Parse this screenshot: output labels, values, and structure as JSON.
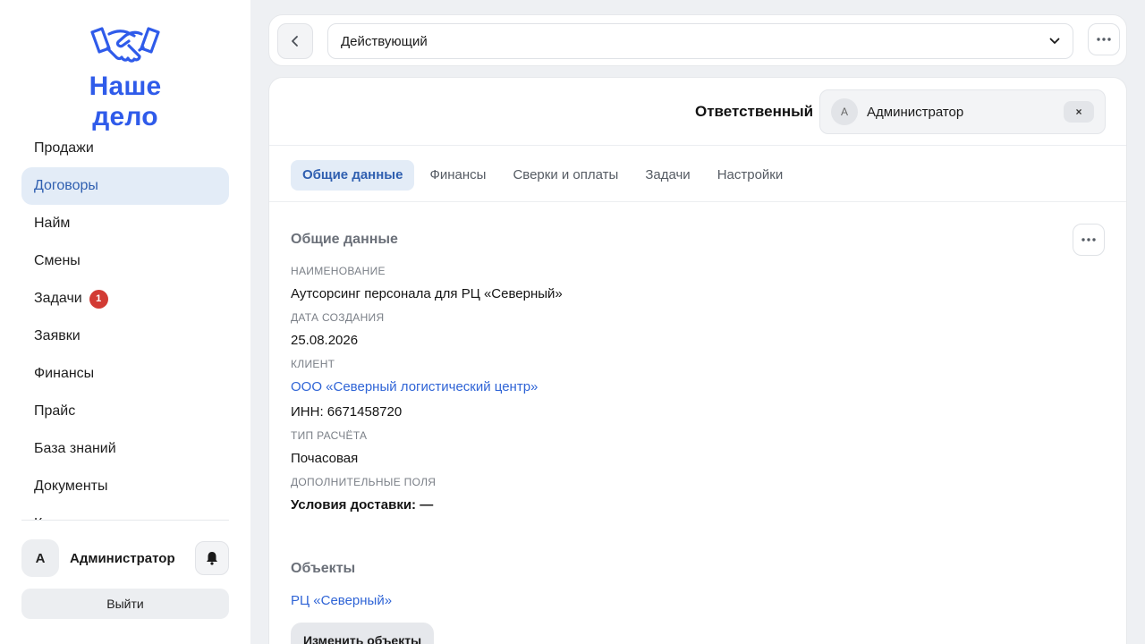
{
  "sidebar": {
    "logo_text": "Наше дело",
    "nav": [
      {
        "label": "Продажи"
      },
      {
        "label": "Договоры",
        "active": true
      },
      {
        "label": "Найм"
      },
      {
        "label": "Смены"
      },
      {
        "label": "Задачи",
        "badge": "1"
      },
      {
        "label": "Заявки"
      },
      {
        "label": "Финансы"
      },
      {
        "label": "Прайс"
      },
      {
        "label": "База знаний"
      },
      {
        "label": "Документы"
      },
      {
        "label": "К"
      }
    ],
    "user": {
      "initial": "А",
      "name": "Администратор"
    },
    "logout_label": "Выйти"
  },
  "topbar": {
    "status_value": "Действующий"
  },
  "card": {
    "responsible_label": "Ответственный",
    "responsible": {
      "initial": "А",
      "name": "Администратор",
      "clear": "×"
    },
    "tabs": [
      "Общие данные",
      "Финансы",
      "Сверки и оплаты",
      "Задачи",
      "Настройки"
    ],
    "active_tab": 0,
    "general": {
      "title": "Общие данные",
      "name_label": "НАИМЕНОВАНИЕ",
      "name_value": "Аутсорсинг персонала для РЦ «Северный»",
      "date_label": "ДАТА СОЗДАНИЯ",
      "date_value": "25.08.2026",
      "client_label": "КЛИЕНТ",
      "client_link": "ООО «Северный логистический центр»",
      "client_inn": "ИНН: 6671458720",
      "calc_label": "ТИП РАСЧЁТА",
      "calc_value": "Почасовая",
      "extra_label": "ДОПОЛНИТЕЛЬНЫЕ ПОЛЯ",
      "extra_value": "Условия доставки: —"
    },
    "objects": {
      "title": "Объекты",
      "link": "РЦ «Северный»",
      "edit_label": "Изменить объекты"
    }
  },
  "colors": {
    "accent": "#2f5bea",
    "active_bg": "#e3ecf7",
    "link": "#2f64d6",
    "badge": "#d23b34"
  }
}
